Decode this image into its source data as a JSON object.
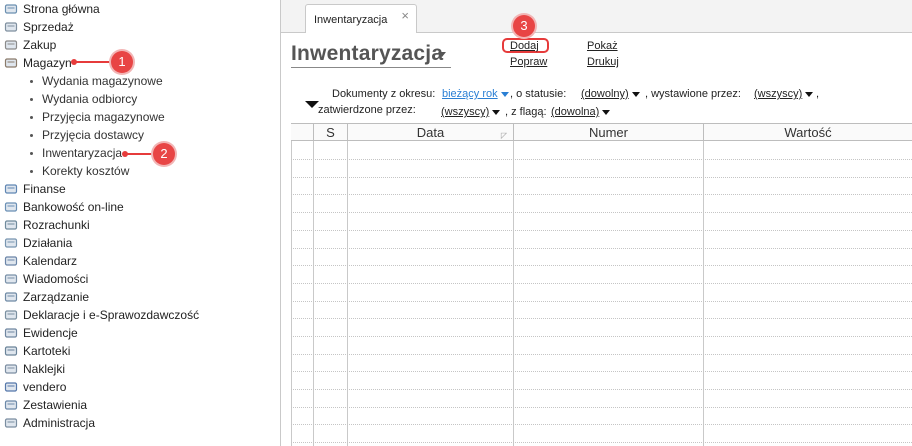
{
  "sidebar": {
    "items": [
      {
        "label": "Strona główna",
        "icon": "home-icon"
      },
      {
        "label": "Sprzedaż",
        "icon": "sales-icon"
      },
      {
        "label": "Zakup",
        "icon": "purchase-icon"
      },
      {
        "label": "Magazyn",
        "icon": "warehouse-icon"
      },
      {
        "label": "Finanse",
        "icon": "finance-icon"
      },
      {
        "label": "Bankowość on-line",
        "icon": "bank-icon"
      },
      {
        "label": "Rozrachunki",
        "icon": "settlements-icon"
      },
      {
        "label": "Działania",
        "icon": "actions-icon"
      },
      {
        "label": "Kalendarz",
        "icon": "calendar-icon"
      },
      {
        "label": "Wiadomości",
        "icon": "messages-icon"
      },
      {
        "label": "Zarządzanie",
        "icon": "management-icon"
      },
      {
        "label": "Deklaracje i e-Sprawozdawczość",
        "icon": "declarations-icon"
      },
      {
        "label": "Ewidencje",
        "icon": "records-icon"
      },
      {
        "label": "Kartoteki",
        "icon": "files-icon"
      },
      {
        "label": "Naklejki",
        "icon": "labels-icon"
      },
      {
        "label": "vendero",
        "icon": "vendero-icon"
      },
      {
        "label": "Zestawienia",
        "icon": "reports-icon"
      },
      {
        "label": "Administracja",
        "icon": "admin-icon"
      }
    ],
    "magazyn_sub": [
      "Wydania magazynowe",
      "Wydania odbiorcy",
      "Przyjęcia magazynowe",
      "Przyjęcia dostawcy",
      "Inwentaryzacja",
      "Korekty kosztów"
    ]
  },
  "callouts": [
    "1",
    "2",
    "3"
  ],
  "tab": {
    "label": "Inwentaryzacja",
    "close": "×"
  },
  "page": {
    "title": "Inwentaryzacja"
  },
  "actions": {
    "dodaj": "Dodaj",
    "popraw": "Popraw",
    "pokaz": "Pokaż",
    "drukuj": "Drukuj"
  },
  "filters": {
    "period_label": "Dokumenty z okresu:",
    "period_value": "bieżący rok",
    "status_label": ", o statusie:",
    "status_value": "(dowolny)",
    "issued_label": ", wystawione przez:",
    "issued_value": "(wszyscy)",
    "issued_sep": ",",
    "approved_label": "zatwierdzone przez:",
    "approved_value": "(wszyscy)",
    "flag_label": ", z flagą:",
    "flag_value": "(dowolna)"
  },
  "table": {
    "columns": [
      "S",
      "Data",
      "Numer",
      "Wartość"
    ]
  },
  "colors": {
    "accent_red": "#e63b3b",
    "link_blue": "#2a7fd4"
  }
}
